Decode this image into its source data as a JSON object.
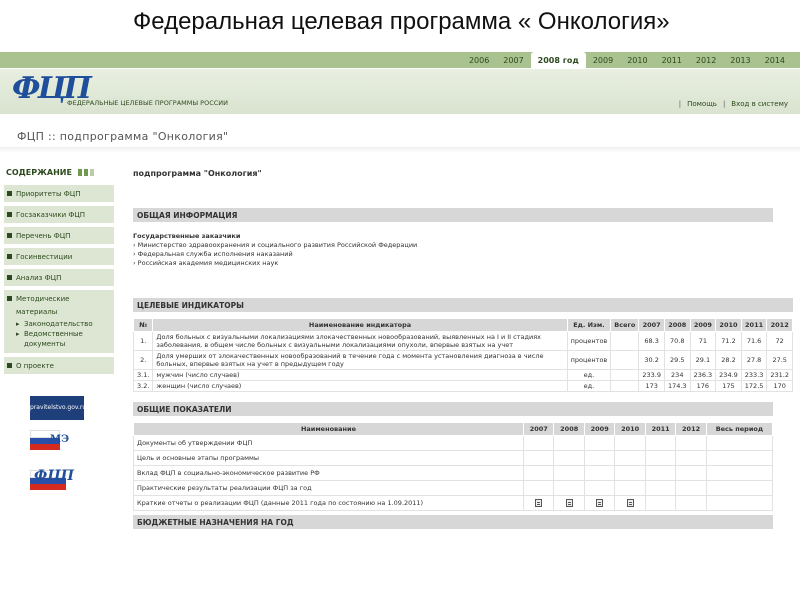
{
  "slide_title": "Федеральная целевая программа « Онкология»",
  "header": {
    "years": [
      "2006",
      "2007",
      "2008 год",
      "2009",
      "2010",
      "2011",
      "2012",
      "2013",
      "2014"
    ],
    "active_year_index": 2,
    "logo_text": "ФЦП",
    "subtitle": "ФЕДЕРАЛЬНЫЕ ЦЕЛЕВЫЕ ПРОГРАММЫ РОССИИ",
    "links": [
      "Помощь",
      "Вход в систему"
    ],
    "brand_green": "#a9c28f",
    "logo_blue": "#1f4e9a"
  },
  "breadcrumb": "ФЦП :: подпрограмма \"Онкология\"",
  "sidebar": {
    "title": "СОДЕРЖАНИЕ",
    "items": [
      {
        "label": "Приоритеты ФЦП"
      },
      {
        "label": "Госзаказчики ФЦП"
      },
      {
        "label": "Перечень ФЦП"
      },
      {
        "label": "Госинвестиции"
      },
      {
        "label": "Анализ ФЦП"
      },
      {
        "label": "Методические материалы",
        "children": [
          "Законодательство",
          "Ведомственные документы"
        ]
      },
      {
        "label": "О проекте"
      }
    ],
    "logos": [
      "pravitelstvo.gov.ru",
      "МЭ",
      "ФЦП"
    ]
  },
  "main": {
    "title": "подпрограмма \"Онкология\"",
    "general_info": {
      "heading": "ОБЩАЯ ИНФОРМАЦИЯ",
      "customers_label": "Государственные заказчики",
      "customers": [
        "Министерство здравоохранения и социального развития Российской Федерации",
        "Федеральная служба исполнения наказаний",
        "Российская академия медицинских наук"
      ]
    },
    "indicators": {
      "heading": "ЦЕЛЕВЫЕ ИНДИКАТОРЫ",
      "columns": [
        "№",
        "Наименование индикатора",
        "Ед. Изм.",
        "Всего",
        "2007",
        "2008",
        "2009",
        "2010",
        "2011",
        "2012"
      ],
      "rows": [
        {
          "num": "1.",
          "name": "Доля больных с визуальными локализациями злокачественных новообразований, выявленных на I и II стадиях заболевания, в общем числе больных с визуальными локализациями опухоли, впервые взятых на учет",
          "unit": "процентов",
          "total": "",
          "values": [
            "68.3",
            "70.8",
            "71",
            "71.2",
            "71.6",
            "72"
          ]
        },
        {
          "num": "2.",
          "name": "Доля умерших от злокачественных новообразований в течение года с момента установления диагноза в числе больных, впервые взятых на учет в предыдущем году",
          "unit": "процентов",
          "total": "",
          "values": [
            "30.2",
            "29.5",
            "29.1",
            "28.2",
            "27.8",
            "27.5"
          ]
        },
        {
          "num": "3.1.",
          "name": "мужчин (число случаев)",
          "unit": "ед.",
          "total": "",
          "values": [
            "233.9",
            "234",
            "236.3",
            "234.9",
            "233.3",
            "231.2"
          ]
        },
        {
          "num": "3.2.",
          "name": "женщин (число случаев)",
          "unit": "ед.",
          "total": "",
          "values": [
            "173",
            "174.3",
            "176",
            "175",
            "172.5",
            "170"
          ]
        }
      ]
    },
    "general_metrics": {
      "heading": "ОБЩИЕ ПОКАЗАТЕЛИ",
      "columns": [
        "Наименование",
        "2007",
        "2008",
        "2009",
        "2010",
        "2011",
        "2012",
        "Весь период"
      ],
      "rows": [
        {
          "name": "Документы об утверждении ФЦП",
          "checks": [
            false,
            false,
            false,
            false,
            false,
            false,
            false
          ]
        },
        {
          "name": "Цель и основные этапы программы",
          "checks": [
            false,
            false,
            false,
            false,
            false,
            false,
            false
          ]
        },
        {
          "name": "Вклад ФЦП в социально-экономическое развитие РФ",
          "checks": [
            false,
            false,
            false,
            false,
            false,
            false,
            false
          ]
        },
        {
          "name": "Практические результаты реализации ФЦП за год",
          "checks": [
            false,
            false,
            false,
            false,
            false,
            false,
            false
          ]
        },
        {
          "name": "Краткие отчеты о реализации ФЦП (данные 2011 года по состоянию на 1.09.2011)",
          "checks": [
            true,
            true,
            true,
            true,
            false,
            false,
            false
          ]
        }
      ]
    },
    "budget": {
      "heading": "БЮДЖЕТНЫЕ НАЗНАЧЕНИЯ НА ГОД"
    }
  }
}
